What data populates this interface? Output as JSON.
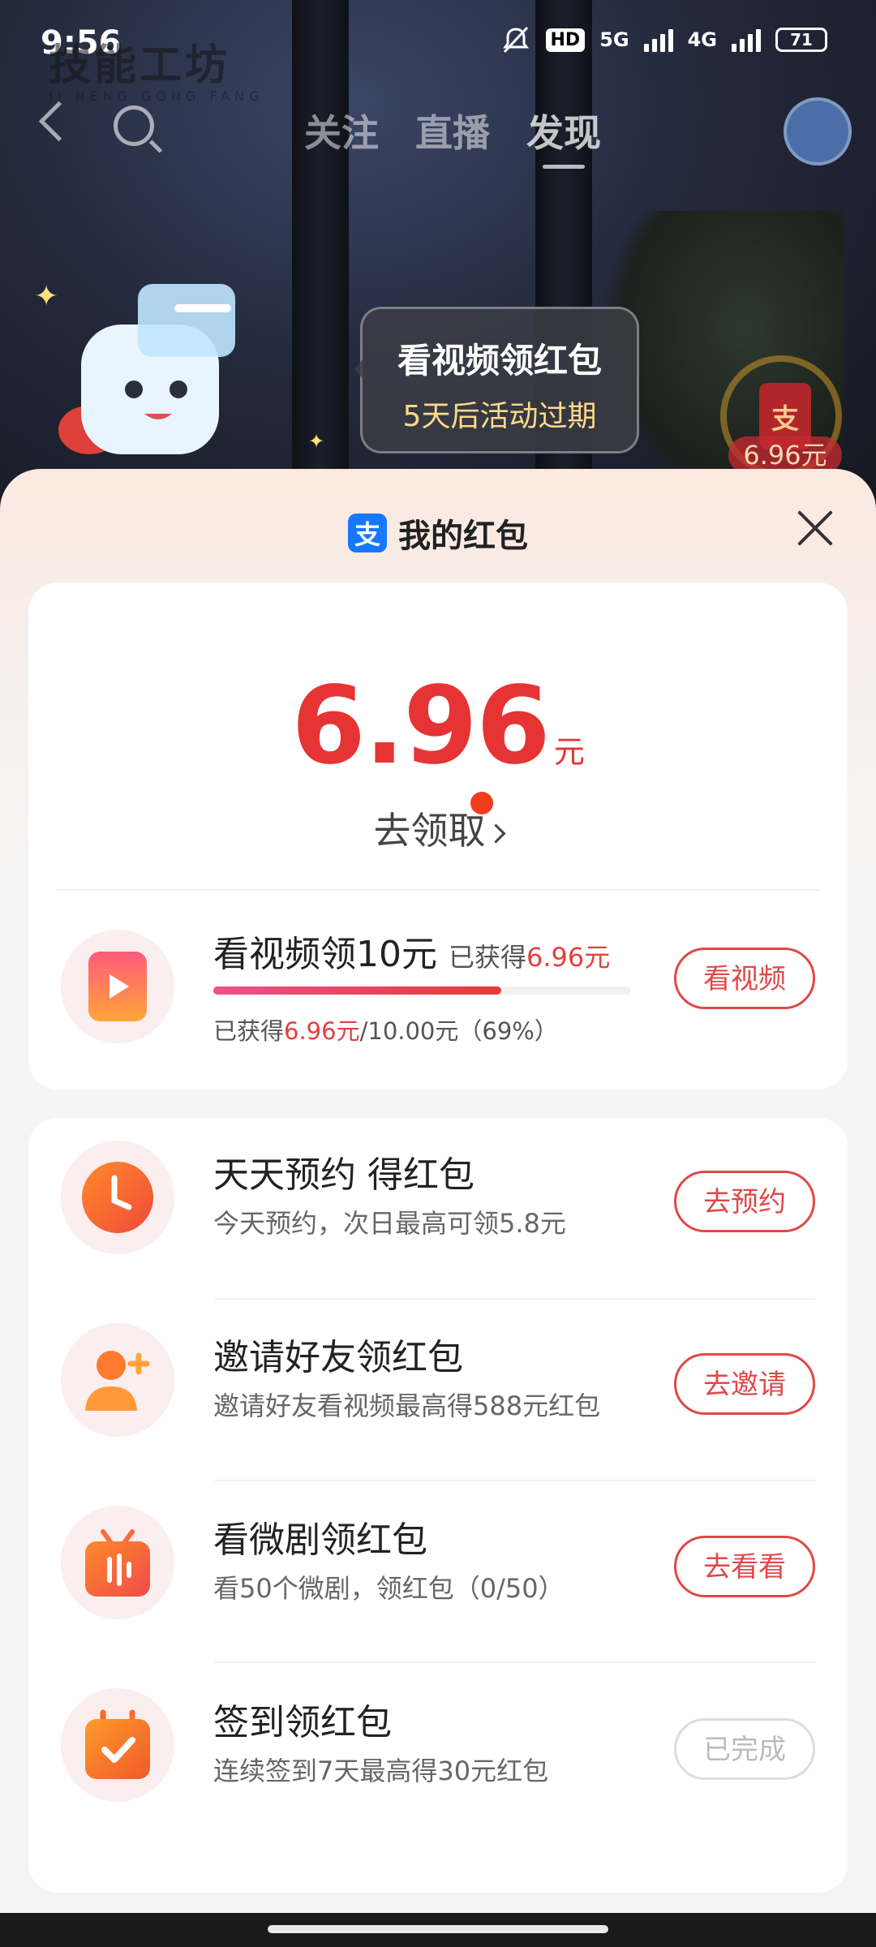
{
  "status_bar": {
    "time": "9:56",
    "network1": "5G",
    "network2": "4G",
    "hd": "HD",
    "battery": "71"
  },
  "watermark": {
    "text": "技能工坊",
    "pinyin": "JI NENG GONG FANG"
  },
  "top_nav": {
    "tabs": [
      "关注",
      "直播",
      "发现"
    ],
    "active_tab": "发现"
  },
  "promo_bubble": {
    "title": "看视频领红包",
    "subtitle": "5天后活动过期"
  },
  "floating_packet": {
    "icon_text": "支",
    "amount": "6.96元"
  },
  "sheet": {
    "alipay_icon": "支",
    "title": "我的红包",
    "balance": {
      "amount": "6.96",
      "unit": "元",
      "claim_label": "去领取"
    },
    "video_task": {
      "title": "看视频领10元",
      "earned_prefix": "已获得",
      "earned_value": "6.96元",
      "progress_percent": 69,
      "progress_prefix": "已获得",
      "progress_value": "6.96元",
      "progress_suffix": "/10.00元（69%）",
      "button": "看视频"
    },
    "tasks": [
      {
        "title": "天天预约 得红包",
        "subtitle": "今天预约，次日最高可领5.8元",
        "button": "去预约",
        "icon": "clock-icon"
      },
      {
        "title": "邀请好友领红包",
        "subtitle": "邀请好友看视频最高得588元红包",
        "button": "去邀请",
        "icon": "add-user-icon"
      },
      {
        "title": "看微剧领红包",
        "subtitle": "看50个微剧，领红包（0/50）",
        "button": "去看看",
        "icon": "tv-icon"
      },
      {
        "title": "签到领红包",
        "subtitle": "连续签到7天最高得30元红包",
        "button": "已完成",
        "icon": "calendar-check-icon"
      }
    ]
  },
  "colors": {
    "accent_red": "#e63434",
    "button_red": "#e04848",
    "alipay_blue": "#1678ff",
    "icon_orange": "#ff7a2e"
  }
}
